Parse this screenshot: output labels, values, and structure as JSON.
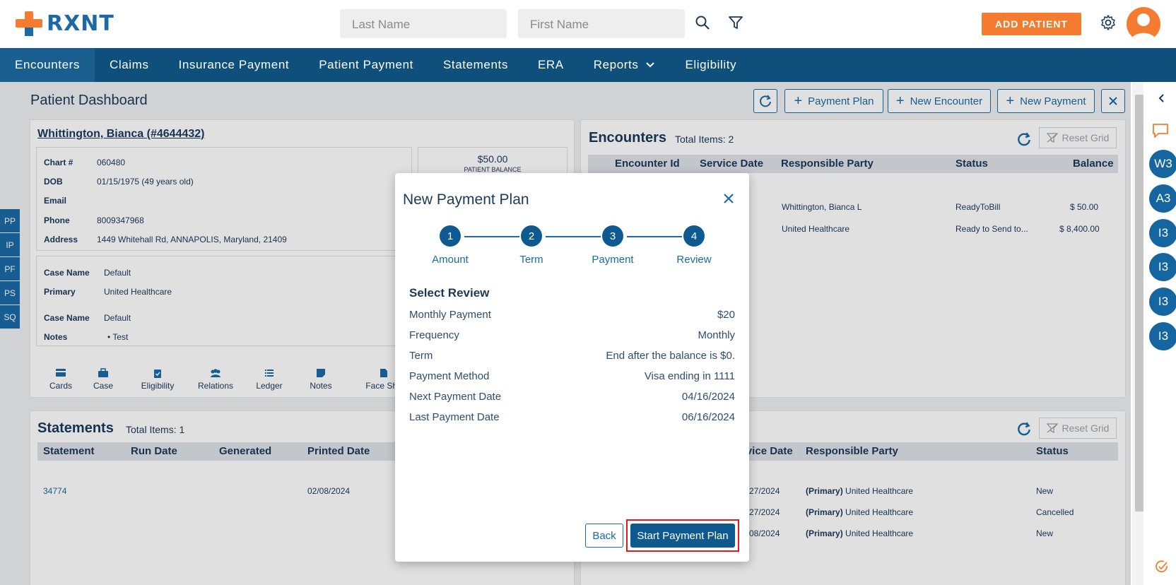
{
  "brand": {
    "name": "RXNT",
    "accent": "#f47b30",
    "primary": "#1b6aa5",
    "nav_bg": "#0e4f7c"
  },
  "header": {
    "last_name_placeholder": "Last Name",
    "first_name_placeholder": "First Name",
    "add_patient_label": "ADD PATIENT"
  },
  "nav": {
    "items": [
      "Encounters",
      "Claims",
      "Insurance Payment",
      "Patient Payment",
      "Statements",
      "ERA",
      "Reports",
      "Eligibility"
    ],
    "active": "Encounters"
  },
  "page": {
    "title": "Patient Dashboard",
    "toolbar": {
      "payment_plan": "Payment Plan",
      "new_encounter": "New Encounter",
      "new_payment": "New Payment"
    }
  },
  "patient": {
    "name": "Whittington, Bianca (#4644432)",
    "fields": [
      {
        "label": "Chart #",
        "value": "060480"
      },
      {
        "label": "DOB",
        "value": "01/15/1975 (49 years old)"
      },
      {
        "label": "Email",
        "value": ""
      },
      {
        "label": "Phone",
        "value": "8009347968"
      },
      {
        "label": "Address",
        "value": "1449 Whitehall Rd, ANNAPOLIS, Maryland, 21409"
      }
    ],
    "balance": "$50.00",
    "balance_label": "PATIENT BALANCE",
    "case1": {
      "case_name_label": "Case Name",
      "case_name": "Default",
      "primary_label": "Primary",
      "primary": "United Healthcare"
    },
    "case2": {
      "case_name_label": "Case Name",
      "case_name": "Default",
      "notes_label": "Notes",
      "note": "Test"
    },
    "actions": [
      "Cards",
      "Case",
      "Eligibility",
      "Relations",
      "Ledger",
      "Notes",
      "Face She"
    ]
  },
  "side_tabs": [
    "PP",
    "IP",
    "PF",
    "PS",
    "SQ"
  ],
  "encounters": {
    "title": "Encounters",
    "total": "Total Items: 2",
    "reset_grid": "Reset Grid",
    "columns": [
      "Encounter Id",
      "Service Date",
      "Responsible Party",
      "Status",
      "Balance"
    ],
    "rows": [
      {
        "party": "Whittington, Bianca L",
        "status": "ReadyToBill",
        "balance": "$ 50.00"
      },
      {
        "party": "United Healthcare",
        "status": "Ready to Send to...",
        "balance": "$ 8,400.00"
      }
    ]
  },
  "statements": {
    "title": "Statements",
    "total": "Total Items: 1",
    "columns": [
      "Statement",
      "Run Date",
      "Generated",
      "Printed Date"
    ],
    "rows": [
      {
        "statement": "34774",
        "printed": "02/08/2024"
      }
    ]
  },
  "claims_grid": {
    "reset_grid": "Reset Grid",
    "columns": [
      "rvice Date",
      "Responsible Party",
      "Status"
    ],
    "rows": [
      {
        "date": "27/2024",
        "prefix": "(Primary)",
        "party": "United Healthcare",
        "status": "New"
      },
      {
        "date": "27/2024",
        "prefix": "(Primary)",
        "party": "United Healthcare",
        "status": "Cancelled"
      },
      {
        "date": "08/2024",
        "prefix": "(Primary)",
        "party": "United Healthcare",
        "status": "New"
      }
    ]
  },
  "rail": {
    "avatars": [
      "W3",
      "A3",
      "I3",
      "I3",
      "I3",
      "I3"
    ]
  },
  "modal": {
    "title": "New Payment Plan",
    "steps": [
      {
        "num": "1",
        "label": "Amount"
      },
      {
        "num": "2",
        "label": "Term"
      },
      {
        "num": "3",
        "label": "Payment"
      },
      {
        "num": "4",
        "label": "Review"
      }
    ],
    "section_title": "Select Review",
    "rows": [
      {
        "label": "Monthly Payment",
        "value": "$20"
      },
      {
        "label": "Frequency",
        "value": "Monthly"
      },
      {
        "label": "Term",
        "value": "End after the balance is $0."
      },
      {
        "label": "Payment Method",
        "value": "Visa ending in 1111"
      },
      {
        "label": "Next Payment Date",
        "value": "04/16/2024"
      },
      {
        "label": "Last Payment Date",
        "value": "06/16/2024"
      }
    ],
    "back_label": "Back",
    "start_label": "Start Payment Plan"
  }
}
